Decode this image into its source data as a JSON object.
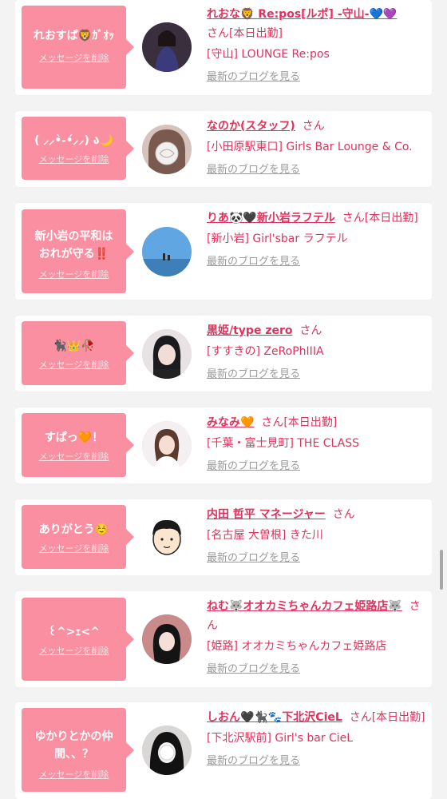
{
  "delete_label": "メッセージを削除",
  "blog_label": "最新のブログを見る",
  "accent_color": "#e0325d",
  "bubble_color": "#f98fa0",
  "items": [
    {
      "message": "れおすぱ🦁ｶﾞｵｯ",
      "name": "れおな🦁 Re:pos[ルポ] -守山-💙💜",
      "suffix": "さん[本日出勤]",
      "shop": "[守山] LOUNGE Re:pos"
    },
    {
      "message": "( ⸝⸝•̀֊•́⸝⸝) ა🌙",
      "name": "なのか(スタッフ)",
      "suffix": "さん",
      "shop": "[小田原駅東口] Girls Bar Lounge & Co."
    },
    {
      "message": "新小岩の平和はおれが守る‼️",
      "name": "りあ🐼🖤新小岩ラフテル",
      "suffix": "さん[本日出勤]",
      "shop": "[新小岩] Girl'sbar ラフテル"
    },
    {
      "message": "🐈‍⬛👑🥀",
      "name": "黒姫/type zero",
      "suffix": "さん",
      "shop": "[すすきの] ZeRoPhIIIA"
    },
    {
      "message": "すぱっ🧡！",
      "name": "みなみ🧡",
      "suffix": "さん[本日出勤]",
      "shop": "[千葉・富士見町] THE CLASS"
    },
    {
      "message": "ありがとう☺️",
      "name": "内田 哲平 マネージャー",
      "suffix": "さん",
      "shop": "[名古屋 大曽根] きた川"
    },
    {
      "message": "꒰^>ｪ<^",
      "name": "ねむ🐺オオカミちゃんカフェ姫路店🐺",
      "suffix": "さん",
      "shop": "[姫路] オオカミちゃんカフェ姫路店"
    },
    {
      "message": "ゆかりとかの仲間、、？",
      "name": "しおん🖤🐈‍⬛🐾下北沢CieL",
      "suffix": "さん[本日出勤]",
      "shop": "[下北沢駅前] Girl's bar CieL"
    }
  ]
}
